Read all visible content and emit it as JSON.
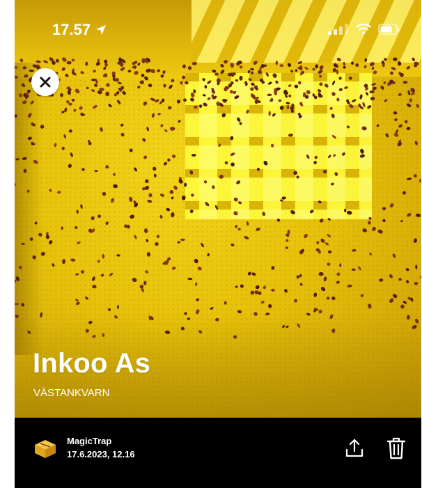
{
  "status_bar": {
    "time": "17.57",
    "location_icon": "location-arrow-icon",
    "signal_icon": "cellular-signal-icon",
    "wifi_icon": "wifi-icon",
    "battery_icon": "battery-icon"
  },
  "photo": {
    "description_icon": "photo",
    "accent_color": "#e8c40d"
  },
  "header": {
    "close_icon": "close-icon"
  },
  "trap": {
    "name": "Inkoo As",
    "location": "VÄSTANKVARN"
  },
  "footer": {
    "device_name": "MagicTrap",
    "timestamp": "17.6.2023, 12.16",
    "device_icon": "trap-box-icon",
    "share_icon": "share-icon",
    "delete_icon": "trash-icon"
  }
}
